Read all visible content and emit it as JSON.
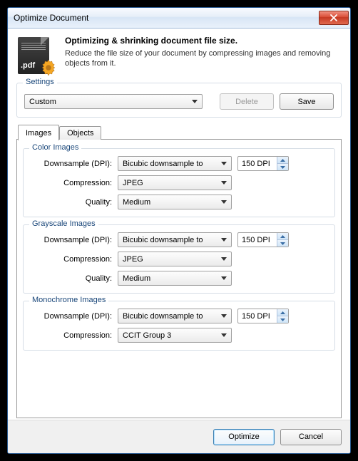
{
  "titlebar": {
    "title": "Optimize Document"
  },
  "header": {
    "icon_label": ".pdf",
    "title": "Optimizing & shrinking document file size.",
    "description": "Reduce the file size of your document by compressing images and removing objects from it."
  },
  "settings": {
    "group_label": "Settings",
    "preset_value": "Custom",
    "delete_label": "Delete",
    "save_label": "Save"
  },
  "tabs": {
    "images_label": "Images",
    "objects_label": "Objects"
  },
  "labels": {
    "downsample": "Downsample (DPI):",
    "compression": "Compression:",
    "quality": "Quality:"
  },
  "groups": {
    "color": {
      "title": "Color Images",
      "downsample_mode": "Bicubic downsample to",
      "dpi": "150 DPI",
      "compression": "JPEG",
      "quality": "Medium"
    },
    "grayscale": {
      "title": "Grayscale Images",
      "downsample_mode": "Bicubic downsample to",
      "dpi": "150 DPI",
      "compression": "JPEG",
      "quality": "Medium"
    },
    "monochrome": {
      "title": "Monochrome Images",
      "downsample_mode": "Bicubic downsample to",
      "dpi": "150 DPI",
      "compression": "CCIT Group 3"
    }
  },
  "footer": {
    "optimize_label": "Optimize",
    "cancel_label": "Cancel"
  }
}
